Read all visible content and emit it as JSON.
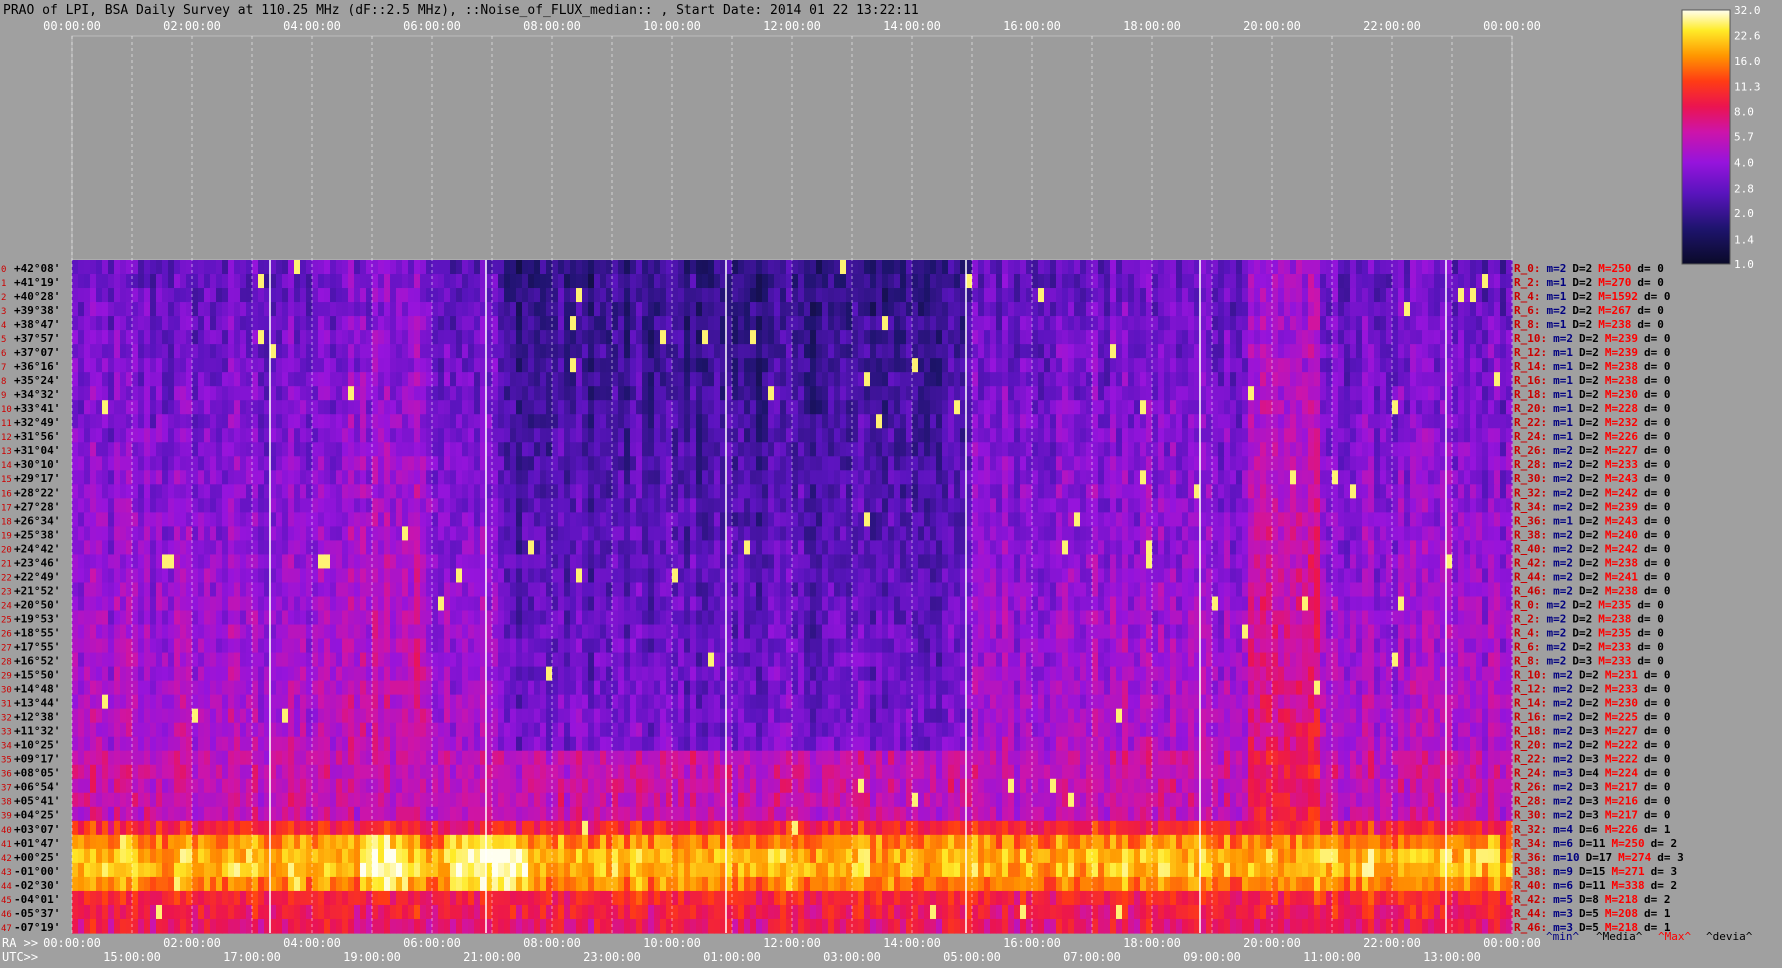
{
  "title": "PRAO of LPI, BSA Daily Survey at 110.25 MHz (dF::2.5 MHz), ::Noise_of_FLUX_median:: , Start Date: 2014 01 22 13:22:11",
  "colors": {
    "background": "#a0a0a0",
    "ra_label": "#000000",
    "row_index": "#cc0000",
    "right_prefix": "#cc0000",
    "min_color": "#000080",
    "max_color": "#ff0000",
    "text_dark": "#000000"
  },
  "chart_data": {
    "type": "heatmap",
    "title": "PRAO of LPI, BSA Daily Survey at 110.25 MHz (dF::2.5 MHz), ::Noise_of_FLUX_median:: , Start Date: 2014 01 22 13:22:11",
    "x_axis_top_ticks": [
      "00:00:00",
      "02:00:00",
      "04:00:00",
      "06:00:00",
      "08:00:00",
      "10:00:00",
      "12:00:00",
      "14:00:00",
      "16:00:00",
      "18:00:00",
      "20:00:00",
      "22:00:00",
      "00:00:00"
    ],
    "x_axis_bottom_ra_label": "RA >>",
    "x_axis_bottom_ra_ticks": [
      "00:00:00",
      "02:00:00",
      "04:00:00",
      "06:00:00",
      "08:00:00",
      "10:00:00",
      "12:00:00",
      "14:00:00",
      "16:00:00",
      "18:00:00",
      "20:00:00",
      "22:00:00",
      "00:00:00"
    ],
    "x_axis_bottom_utc_label": "UTC>>",
    "x_axis_bottom_utc_ticks": [
      "15:00:00",
      "17:00:00",
      "19:00:00",
      "21:00:00",
      "23:00:00",
      "01:00:00",
      "03:00:00",
      "05:00:00",
      "07:00:00",
      "09:00:00",
      "11:00:00",
      "13:00:00"
    ],
    "x_range_hours": [
      0,
      24
    ],
    "y_declination_labels": [
      "+42°08'",
      "+41°19'",
      "+40°28'",
      "+39°38'",
      "+38°47'",
      "+37°57'",
      "+37°07'",
      "+36°16'",
      "+35°24'",
      "+34°32'",
      "+33°41'",
      "+32°49'",
      "+31°56'",
      "+31°04'",
      "+30°10'",
      "+29°17'",
      "+28°22'",
      "+27°28'",
      "+26°34'",
      "+25°38'",
      "+24°42'",
      "+23°46'",
      "+22°49'",
      "+21°52'",
      "+20°50'",
      "+19°53'",
      "+18°55'",
      "+17°55'",
      "+16°52'",
      "+15°50'",
      "+14°48'",
      "+13°44'",
      "+12°38'",
      "+11°32'",
      "+10°25'",
      "+09°17'",
      "+08°05'",
      "+06°54'",
      "+05°41'",
      "+04°25'",
      "+03°07'",
      "+01°47'",
      "+00°25'",
      "-01°00'",
      "-02°30'",
      "-04°01'",
      "-05°37'",
      "-07°19'"
    ],
    "colorbar_ticks": [
      "32.0",
      "22.6",
      "16.0",
      "11.3",
      "8.0",
      "5.7",
      "4.0",
      "2.8",
      "2.0",
      "1.4",
      "1.0"
    ],
    "colorbar_range": [
      1.0,
      32.0
    ],
    "colorbar_scale": "log",
    "right_footer": [
      "^min^",
      "^Media^",
      "^Max^",
      "^devia^"
    ],
    "rows": [
      {
        "label": "R_0:",
        "m": "m=2",
        "D": "D=2",
        "M": "M=250",
        "d": "d= 0"
      },
      {
        "label": "R_2:",
        "m": "m=1",
        "D": "D=2",
        "M": "M=270",
        "d": "d= 0"
      },
      {
        "label": "R_4:",
        "m": "m=1",
        "D": "D=2",
        "M": "M=1592",
        "d": "d= 0"
      },
      {
        "label": "R_6:",
        "m": "m=2",
        "D": "D=2",
        "M": "M=267",
        "d": "d= 0"
      },
      {
        "label": "R_8:",
        "m": "m=1",
        "D": "D=2",
        "M": "M=238",
        "d": "d= 0"
      },
      {
        "label": "R_10:",
        "m": "m=2",
        "D": "D=2",
        "M": "M=239",
        "d": "d= 0"
      },
      {
        "label": "R_12:",
        "m": "m=1",
        "D": "D=2",
        "M": "M=239",
        "d": "d= 0"
      },
      {
        "label": "R_14:",
        "m": "m=1",
        "D": "D=2",
        "M": "M=238",
        "d": "d= 0"
      },
      {
        "label": "R_16:",
        "m": "m=1",
        "D": "D=2",
        "M": "M=238",
        "d": "d= 0"
      },
      {
        "label": "R_18:",
        "m": "m=1",
        "D": "D=2",
        "M": "M=230",
        "d": "d= 0"
      },
      {
        "label": "R_20:",
        "m": "m=1",
        "D": "D=2",
        "M": "M=228",
        "d": "d= 0"
      },
      {
        "label": "R_22:",
        "m": "m=1",
        "D": "D=2",
        "M": "M=232",
        "d": "d= 0"
      },
      {
        "label": "R_24:",
        "m": "m=1",
        "D": "D=2",
        "M": "M=226",
        "d": "d= 0"
      },
      {
        "label": "R_26:",
        "m": "m=2",
        "D": "D=2",
        "M": "M=227",
        "d": "d= 0"
      },
      {
        "label": "R_28:",
        "m": "m=2",
        "D": "D=2",
        "M": "M=233",
        "d": "d= 0"
      },
      {
        "label": "R_30:",
        "m": "m=2",
        "D": "D=2",
        "M": "M=243",
        "d": "d= 0"
      },
      {
        "label": "R_32:",
        "m": "m=2",
        "D": "D=2",
        "M": "M=242",
        "d": "d= 0"
      },
      {
        "label": "R_34:",
        "m": "m=2",
        "D": "D=2",
        "M": "M=239",
        "d": "d= 0"
      },
      {
        "label": "R_36:",
        "m": "m=1",
        "D": "D=2",
        "M": "M=243",
        "d": "d= 0"
      },
      {
        "label": "R_38:",
        "m": "m=2",
        "D": "D=2",
        "M": "M=240",
        "d": "d= 0"
      },
      {
        "label": "R_40:",
        "m": "m=2",
        "D": "D=2",
        "M": "M=242",
        "d": "d= 0"
      },
      {
        "label": "R_42:",
        "m": "m=2",
        "D": "D=2",
        "M": "M=238",
        "d": "d= 0"
      },
      {
        "label": "R_44:",
        "m": "m=2",
        "D": "D=2",
        "M": "M=241",
        "d": "d= 0"
      },
      {
        "label": "R_46:",
        "m": "m=2",
        "D": "D=2",
        "M": "M=238",
        "d": "d= 0"
      },
      {
        "label": "R_0:",
        "m": "m=2",
        "D": "D=2",
        "M": "M=235",
        "d": "d= 0"
      },
      {
        "label": "R_2:",
        "m": "m=2",
        "D": "D=2",
        "M": "M=238",
        "d": "d= 0"
      },
      {
        "label": "R_4:",
        "m": "m=2",
        "D": "D=2",
        "M": "M=235",
        "d": "d= 0"
      },
      {
        "label": "R_6:",
        "m": "m=2",
        "D": "D=2",
        "M": "M=233",
        "d": "d= 0"
      },
      {
        "label": "R_8:",
        "m": "m=2",
        "D": "D=3",
        "M": "M=233",
        "d": "d= 0"
      },
      {
        "label": "R_10:",
        "m": "m=2",
        "D": "D=2",
        "M": "M=231",
        "d": "d= 0"
      },
      {
        "label": "R_12:",
        "m": "m=2",
        "D": "D=2",
        "M": "M=233",
        "d": "d= 0"
      },
      {
        "label": "R_14:",
        "m": "m=2",
        "D": "D=2",
        "M": "M=230",
        "d": "d= 0"
      },
      {
        "label": "R_16:",
        "m": "m=2",
        "D": "D=2",
        "M": "M=225",
        "d": "d= 0"
      },
      {
        "label": "R_18:",
        "m": "m=2",
        "D": "D=3",
        "M": "M=227",
        "d": "d= 0"
      },
      {
        "label": "R_20:",
        "m": "m=2",
        "D": "D=2",
        "M": "M=222",
        "d": "d= 0"
      },
      {
        "label": "R_22:",
        "m": "m=2",
        "D": "D=3",
        "M": "M=222",
        "d": "d= 0"
      },
      {
        "label": "R_24:",
        "m": "m=3",
        "D": "D=4",
        "M": "M=224",
        "d": "d= 0"
      },
      {
        "label": "R_26:",
        "m": "m=2",
        "D": "D=3",
        "M": "M=217",
        "d": "d= 0"
      },
      {
        "label": "R_28:",
        "m": "m=2",
        "D": "D=3",
        "M": "M=216",
        "d": "d= 0"
      },
      {
        "label": "R_30:",
        "m": "m=2",
        "D": "D=3",
        "M": "M=217",
        "d": "d= 0"
      },
      {
        "label": "R_32:",
        "m": "m=4",
        "D": "D=6",
        "M": "M=226",
        "d": "d= 1"
      },
      {
        "label": "R_34:",
        "m": "m=6",
        "D": "D=11",
        "M": "M=250",
        "d": "d= 2"
      },
      {
        "label": "R_36:",
        "m": "m=10",
        "D": "D=17",
        "M": "M=274",
        "d": "d= 3"
      },
      {
        "label": "R_38:",
        "m": "m=9",
        "D": "D=15",
        "M": "M=271",
        "d": "d= 3"
      },
      {
        "label": "R_40:",
        "m": "m=6",
        "D": "D=11",
        "M": "M=338",
        "d": "d= 2"
      },
      {
        "label": "R_42:",
        "m": "m=5",
        "D": "D=8",
        "M": "M=218",
        "d": "d= 2"
      },
      {
        "label": "R_44:",
        "m": "m=3",
        "D": "D=5",
        "M": "M=208",
        "d": "d= 1"
      },
      {
        "label": "R_46:",
        "m": "m=3",
        "D": "D=5",
        "M": "M=218",
        "d": "d= 1"
      }
    ]
  }
}
